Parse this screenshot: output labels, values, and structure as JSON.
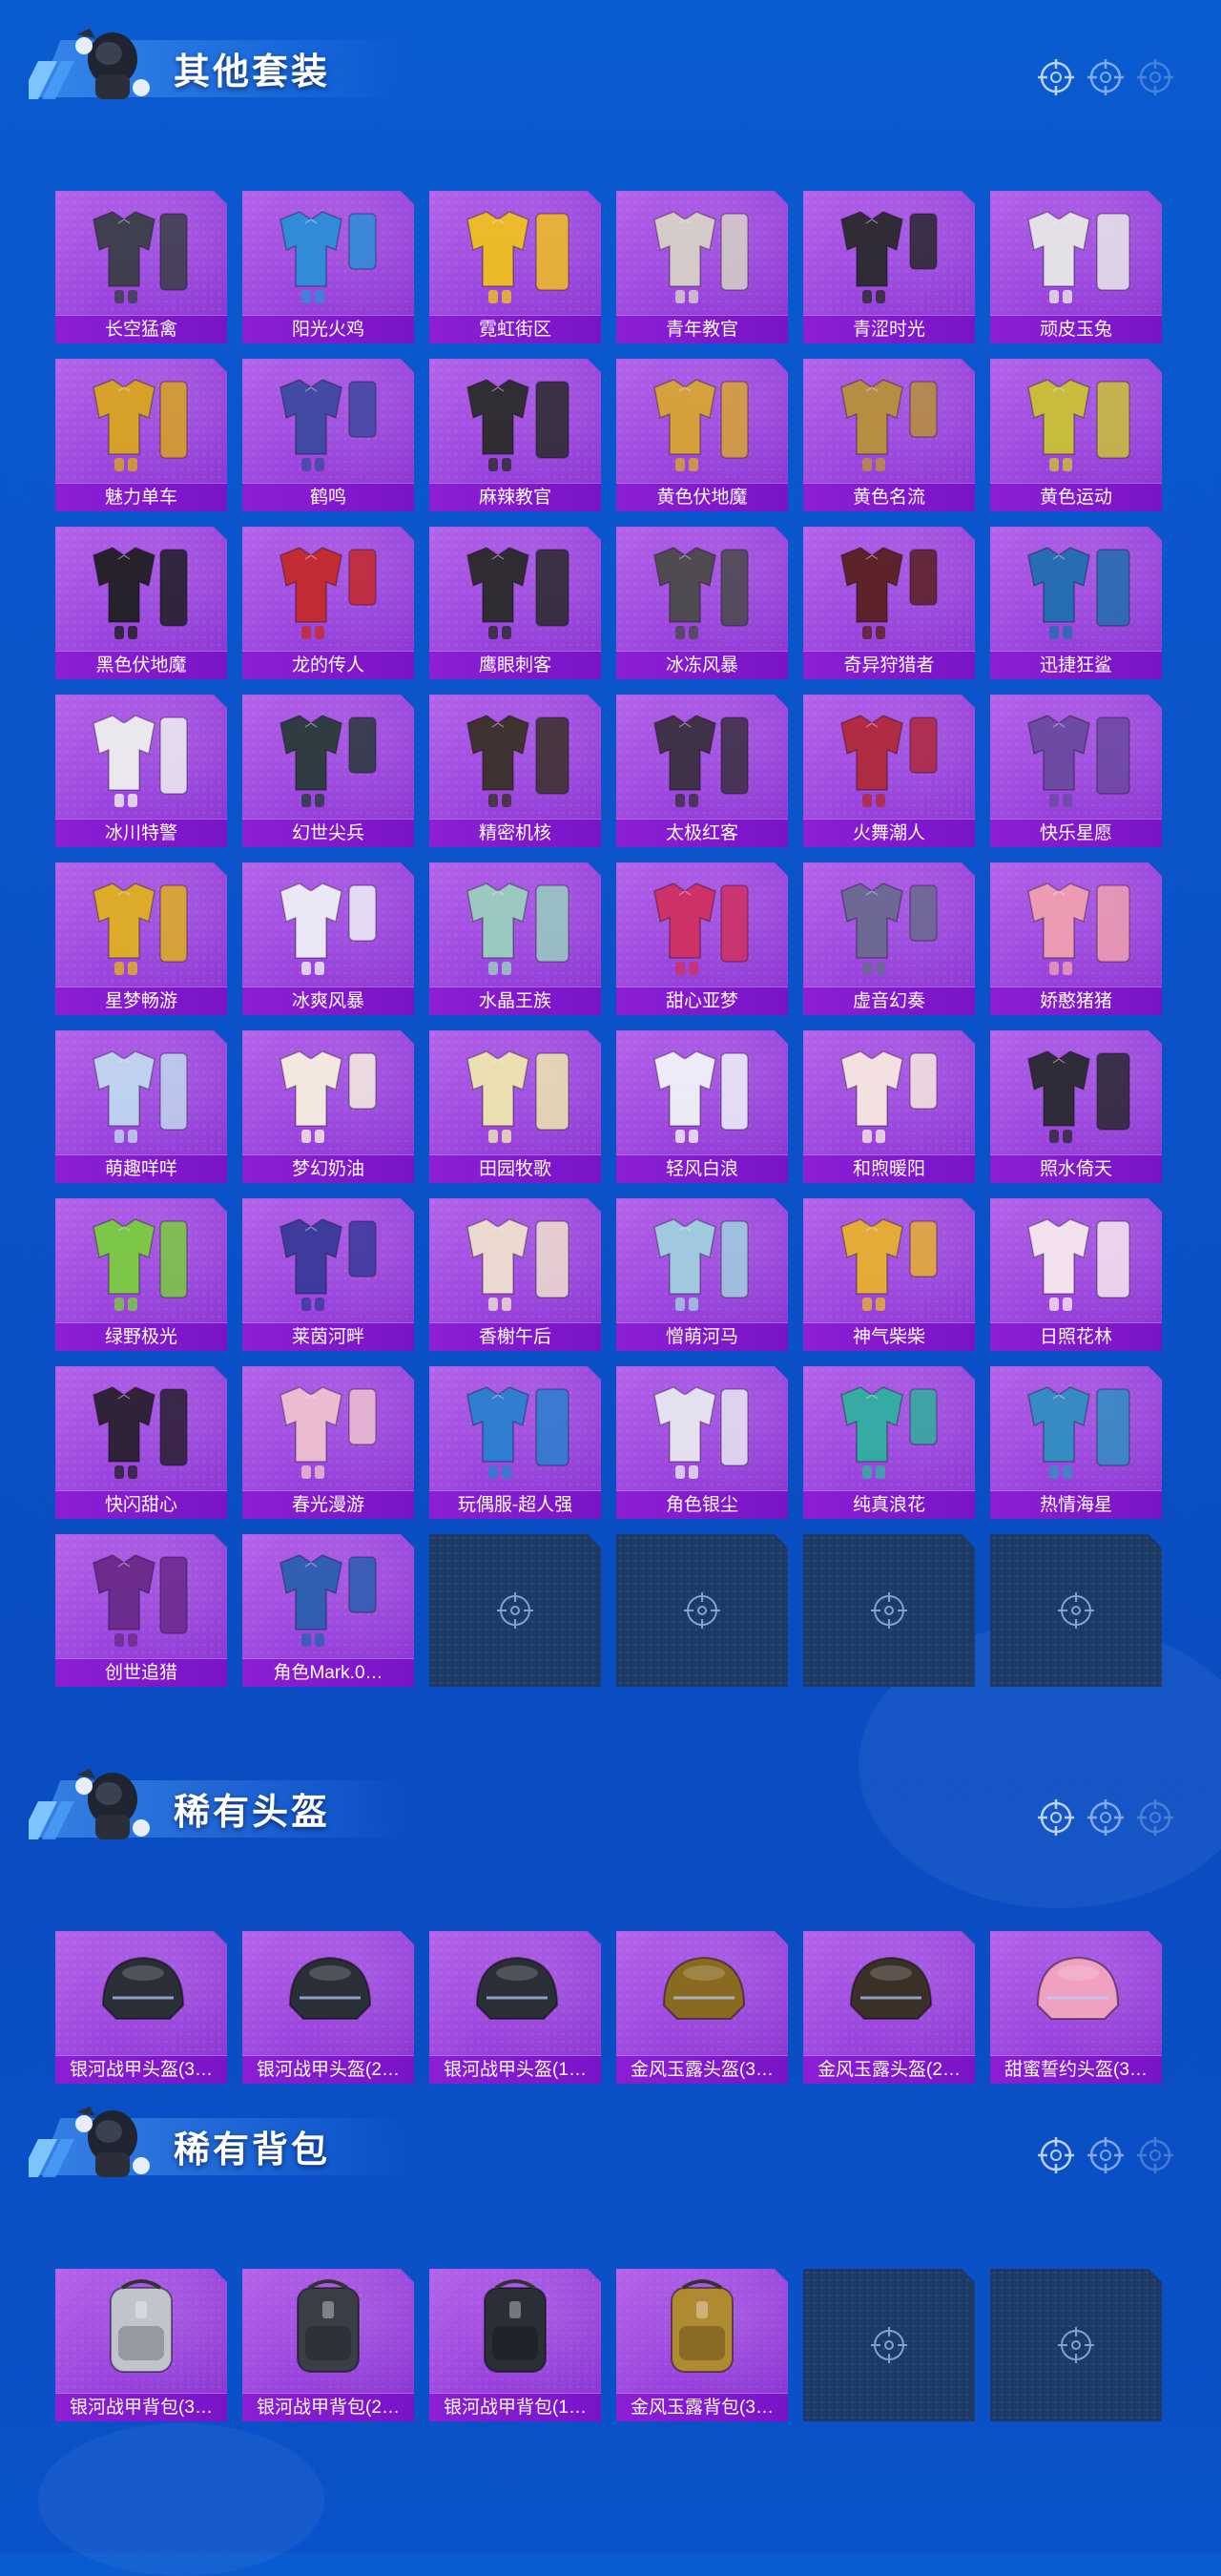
{
  "sections": [
    {
      "title": "其他套装",
      "items": [
        {
          "label": "长空猛禽",
          "color": "#3a3f48"
        },
        {
          "label": "阳光火鸡",
          "color": "#2c8fd8"
        },
        {
          "label": "霓虹街区",
          "color": "#f0c020"
        },
        {
          "label": "青年教官",
          "color": "#d7d2c8"
        },
        {
          "label": "青涩时光",
          "color": "#2a2a2e"
        },
        {
          "label": "顽皮玉兔",
          "color": "#e8e8e8"
        },
        {
          "label": "魅力单车",
          "color": "#d9a520"
        },
        {
          "label": "鹤鸣",
          "color": "#3d4aa0"
        },
        {
          "label": "麻辣教官",
          "color": "#2b2b2b"
        },
        {
          "label": "黄色伏地魔",
          "color": "#d8a534"
        },
        {
          "label": "黄色名流",
          "color": "#b7913b"
        },
        {
          "label": "黄色运动",
          "color": "#c9c236"
        },
        {
          "label": "黑色伏地魔",
          "color": "#1f1f22"
        },
        {
          "label": "龙的传人",
          "color": "#c42a2a"
        },
        {
          "label": "鹰眼刺客",
          "color": "#2a2a2a"
        },
        {
          "label": "冰冻风暴",
          "color": "#4a4a4a"
        },
        {
          "label": "奇异狩猎者",
          "color": "#5a2020"
        },
        {
          "label": "迅捷狂鲨",
          "color": "#1f6fb0"
        },
        {
          "label": "冰川特警",
          "color": "#f0f0f0"
        },
        {
          "label": "幻世尖兵",
          "color": "#2a3a3a"
        },
        {
          "label": "精密机核",
          "color": "#3a3028"
        },
        {
          "label": "太极红客",
          "color": "#3a3040"
        },
        {
          "label": "火舞潮人",
          "color": "#b02a3a"
        },
        {
          "label": "快乐星愿",
          "color": "#6a4aa0"
        },
        {
          "label": "星梦畅游",
          "color": "#e0b020"
        },
        {
          "label": "冰爽风暴",
          "color": "#f0f0f8"
        },
        {
          "label": "水晶王族",
          "color": "#9ad0c0"
        },
        {
          "label": "甜心亚梦",
          "color": "#d03060"
        },
        {
          "label": "虚音幻奏",
          "color": "#6a6a90"
        },
        {
          "label": "娇憨猪猪",
          "color": "#f0a0b0"
        },
        {
          "label": "萌趣咩咩",
          "color": "#c0d8f0"
        },
        {
          "label": "梦幻奶油",
          "color": "#f8f0e0"
        },
        {
          "label": "田园牧歌",
          "color": "#f0e8b0"
        },
        {
          "label": "轻风白浪",
          "color": "#f0f4f8"
        },
        {
          "label": "和煦暖阳",
          "color": "#f8e8e0"
        },
        {
          "label": "照水倚天",
          "color": "#2a2a30"
        },
        {
          "label": "绿野极光",
          "color": "#7acc40"
        },
        {
          "label": "莱茵河畔",
          "color": "#3a3a9a"
        },
        {
          "label": "香榭午后",
          "color": "#f0e0d0"
        },
        {
          "label": "憎萌河马",
          "color": "#a0d0e0"
        },
        {
          "label": "神气柴柴",
          "color": "#e8b030"
        },
        {
          "label": "日照花林",
          "color": "#f8e8f0"
        },
        {
          "label": "快闪甜心",
          "color": "#2a2030"
        },
        {
          "label": "春光漫游",
          "color": "#f0c0d0"
        },
        {
          "label": "玩偶服-超人强",
          "color": "#2a80d0"
        },
        {
          "label": "角色银尘",
          "color": "#e8e8f0"
        },
        {
          "label": "纯真浪花",
          "color": "#30b0a0"
        },
        {
          "label": "热情海星",
          "color": "#3090c0"
        },
        {
          "label": "创世追猎",
          "color": "#6a2a8a"
        },
        {
          "label": "角色Mark.0…",
          "color": "#2a60b0"
        }
      ],
      "empty_slots": 4
    },
    {
      "title": "稀有头盔",
      "items": [
        {
          "label": "银河战甲头盔(3…",
          "color": "#2a2e36"
        },
        {
          "label": "银河战甲头盔(2…",
          "color": "#2a2e36"
        },
        {
          "label": "银河战甲头盔(1…",
          "color": "#2a2e36"
        },
        {
          "label": "金风玉露头盔(3…",
          "color": "#8a6a20"
        },
        {
          "label": "金风玉露头盔(2…",
          "color": "#3a3028"
        },
        {
          "label": "甜蜜誓约头盔(3…",
          "color": "#f0a0c0"
        }
      ],
      "empty_slots": 0
    },
    {
      "title": "稀有背包",
      "items": [
        {
          "label": "银河战甲背包(3…",
          "color": "#c0c4cc"
        },
        {
          "label": "银河战甲背包(2…",
          "color": "#3a3e46"
        },
        {
          "label": "银河战甲背包(1…",
          "color": "#2a2e36"
        },
        {
          "label": "金风玉露背包(3…",
          "color": "#b08a30"
        }
      ],
      "empty_slots": 2
    }
  ]
}
